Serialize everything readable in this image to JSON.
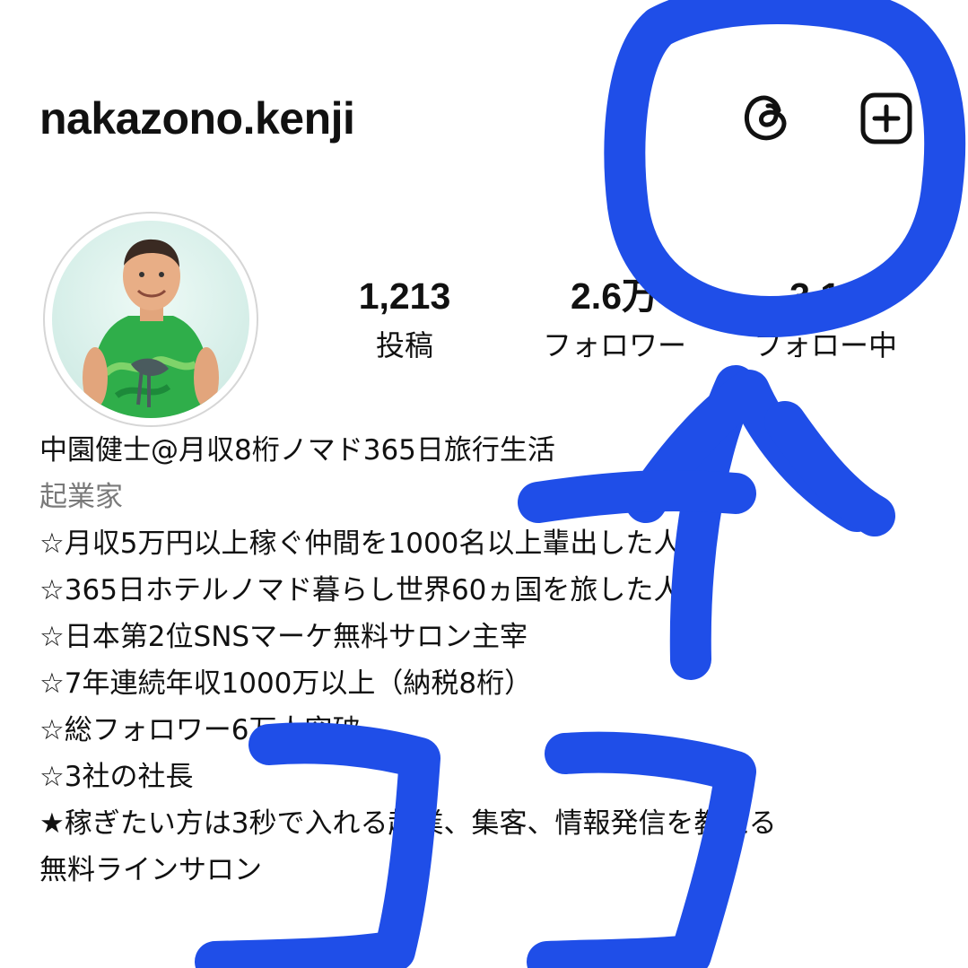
{
  "header": {
    "username": "nakazono.kenji",
    "icons": [
      "threads-icon",
      "create-post-icon"
    ]
  },
  "stats": {
    "posts": {
      "value": "1,213",
      "label": "投稿"
    },
    "followers": {
      "value": "2.6万",
      "label": "フォロワー"
    },
    "following": {
      "value": "3.14",
      "label": "フォロー中"
    }
  },
  "bio": {
    "name": "中園健士@月収8桁ノマド365日旅行生活",
    "category": "起業家",
    "lines": [
      "☆月収5万円以上稼ぐ仲間を1000名以上輩出した人",
      "☆365日ホテルノマド暮らし世界60ヵ国を旅した人",
      "☆日本第2位SNSマーケ無料サロン主宰",
      "☆7年連続年収1000万以上（納税8桁）",
      "☆総フォロワー6万人突破",
      "☆3社の社長",
      "★稼ぎたい方は3秒で入れる起業、集客、情報発信を教える",
      "無料ラインサロン"
    ]
  },
  "colors": {
    "annotation": "#1f4ee8",
    "text": "#111111",
    "muted": "#7a7a7a"
  }
}
